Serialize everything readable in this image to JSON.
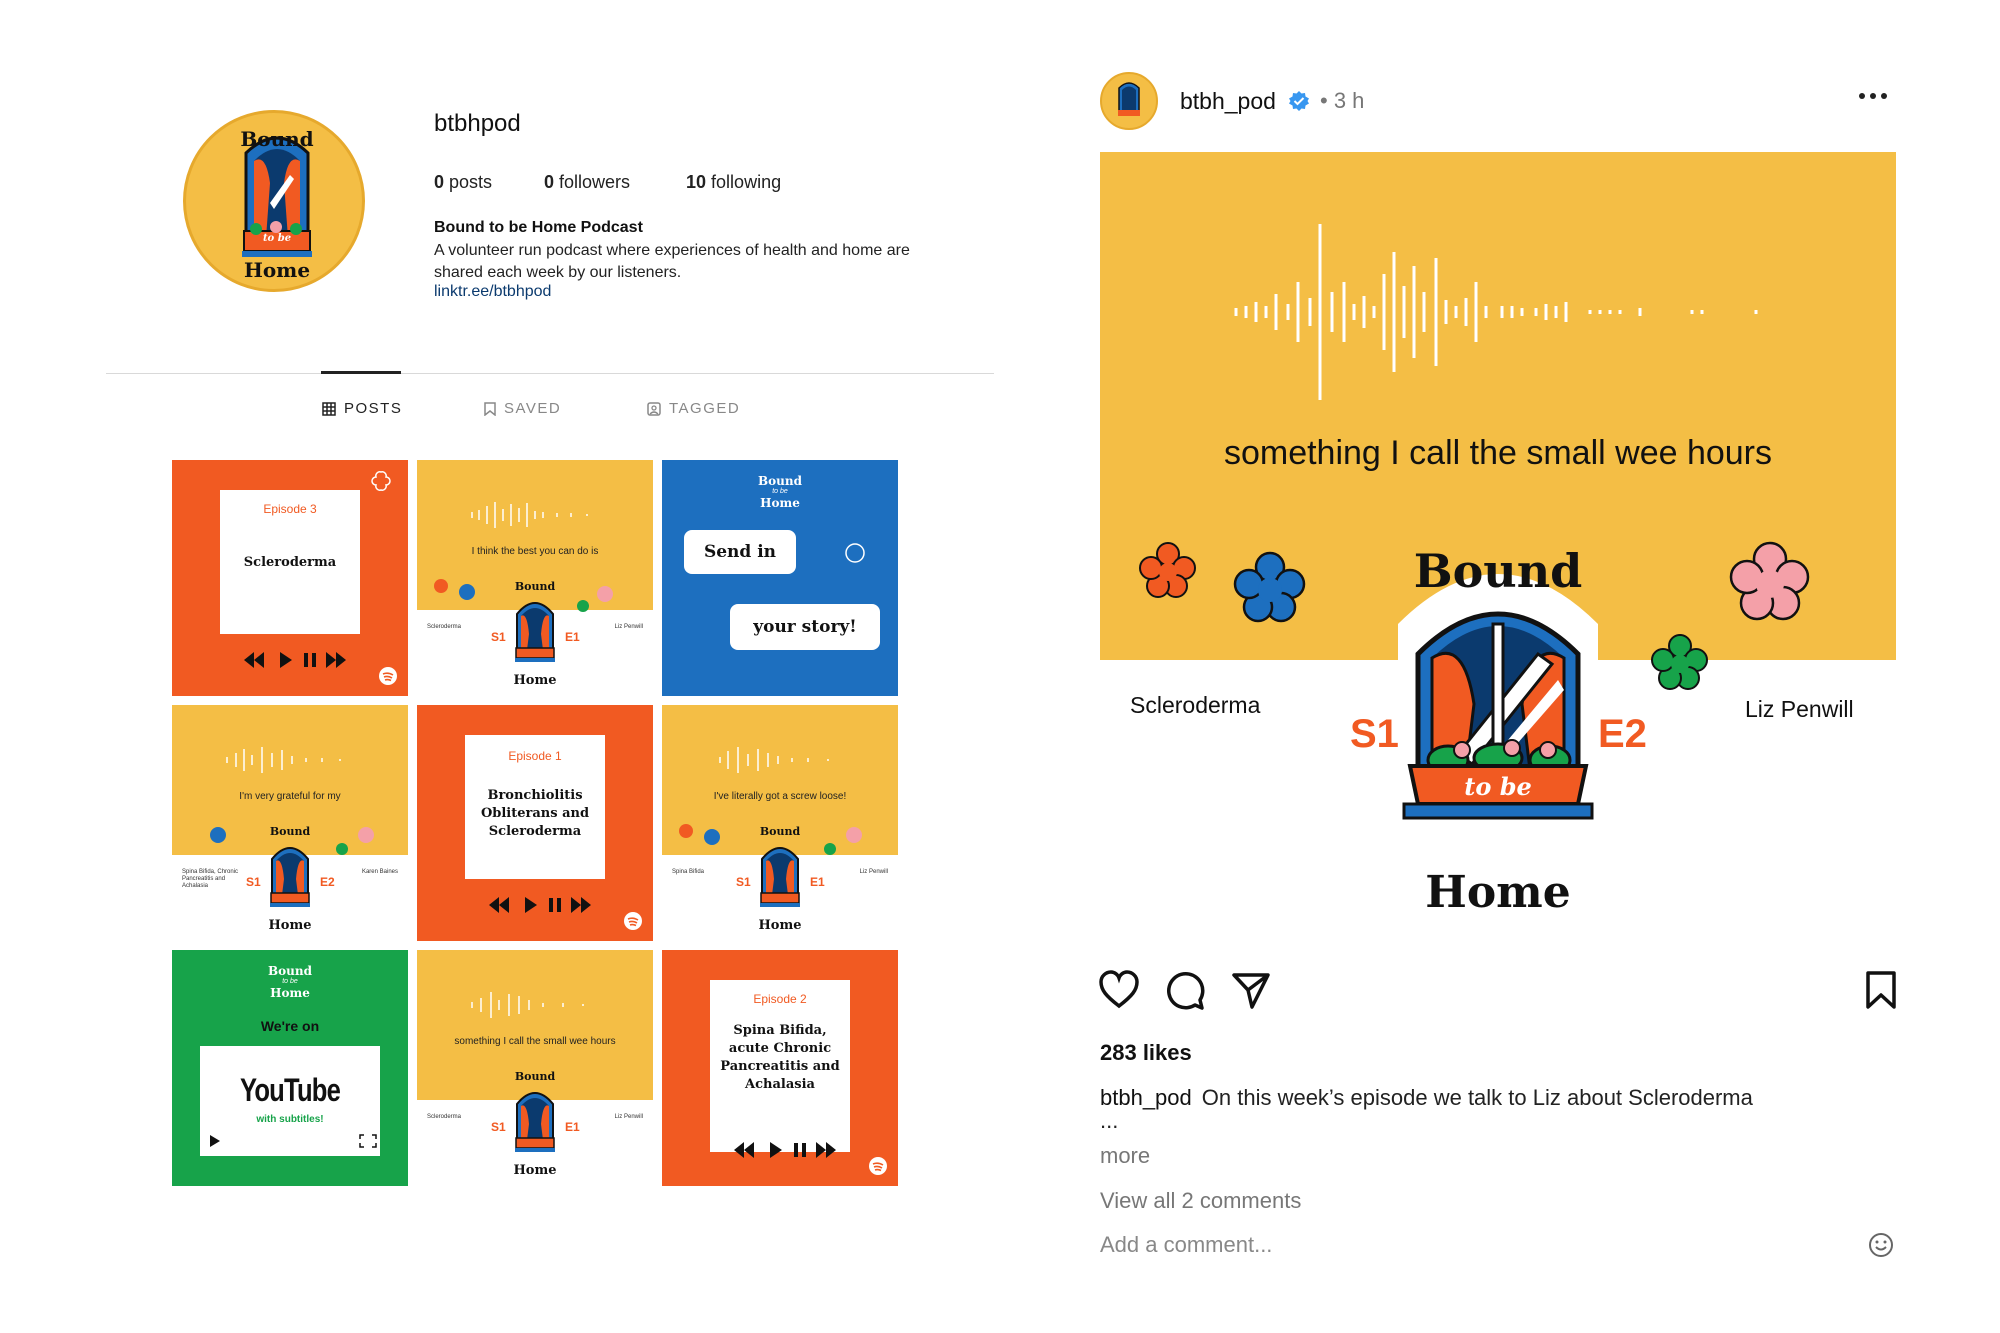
{
  "profile": {
    "username": "btbhpod",
    "stats": {
      "posts": "0",
      "posts_label": "posts",
      "followers": "0",
      "followers_label": "followers",
      "following": "10",
      "following_label": "following"
    },
    "bio_name": "Bound to be Home Podcast",
    "bio_text": "A volunteer run podcast where experiences of health and home are shared each week by our listeners.",
    "bio_link": "linktr.ee/btbhpod",
    "avatar_words": {
      "top": "Bound",
      "middle": "to be",
      "bottom": "Home"
    }
  },
  "tabs": [
    {
      "label": "POSTS",
      "icon": "grid-icon"
    },
    {
      "label": "SAVED",
      "icon": "bookmark-icon"
    },
    {
      "label": "TAGGED",
      "icon": "tag-icon"
    }
  ],
  "grid": {
    "t1": {
      "episode": "Episode 3",
      "title": "Scleroderma"
    },
    "t2": {
      "quote": "I think the best you can do is",
      "left": "Scleroderma",
      "right": "Liz Penwill",
      "s": "S1",
      "e": "E1",
      "bound": "Bound",
      "home": "Home"
    },
    "t3": {
      "bound": "Bound",
      "tobe": "to be",
      "home": "Home",
      "bubble1": "Send in",
      "bubble2": "your story!"
    },
    "t4": {
      "quote": "I'm very grateful for my",
      "left": "Spina Bifida, Chronic Pancreatitis and Achalasia",
      "right": "Karen Baines",
      "s": "S1",
      "e": "E2",
      "bound": "Bound",
      "home": "Home"
    },
    "t5": {
      "episode": "Episode 1",
      "title": "Bronchiolitis Obliterans and Scleroderma"
    },
    "t6": {
      "quote": "I've literally got a screw loose!",
      "left": "Spina Bifida",
      "right": "Liz Penwill",
      "s": "S1",
      "e": "E1",
      "bound": "Bound",
      "home": "Home"
    },
    "t7": {
      "bound": "Bound",
      "tobe": "to be",
      "home": "Home",
      "on": "We're on",
      "brand": "YouTube",
      "sub": "with subtitles!"
    },
    "t8": {
      "quote": "something I call the small wee hours",
      "left": "Scleroderma",
      "right": "Liz Penwill",
      "s": "S1",
      "e": "E1",
      "bound": "Bound",
      "home": "Home"
    },
    "t9": {
      "episode": "Episode 2",
      "title": "Spina Bifida, acute Chronic Pancreatitis and Achalasia"
    }
  },
  "post": {
    "username": "btbh_pod",
    "time": "• 3 h",
    "quote": "something I call the small wee hours",
    "left_name": "Scleroderma",
    "right_name": "Liz Penwill",
    "season": "S1",
    "episode": "E2",
    "bound": "Bound",
    "tobe": "to be",
    "home": "Home",
    "likes": "283 likes",
    "caption_user": "btbh_pod",
    "caption": "On this week’s episode we talk to Liz about Scleroderma",
    "caption_ellipsis": "...",
    "more": "more",
    "view_comments": "View all 2 comments",
    "add_comment_placeholder": "Add a comment..."
  },
  "colors": {
    "orange": "#f15a22",
    "yellow": "#f4be45",
    "blue": "#1d6fbf",
    "green": "#17a34a",
    "navy": "#0b3a6e"
  }
}
